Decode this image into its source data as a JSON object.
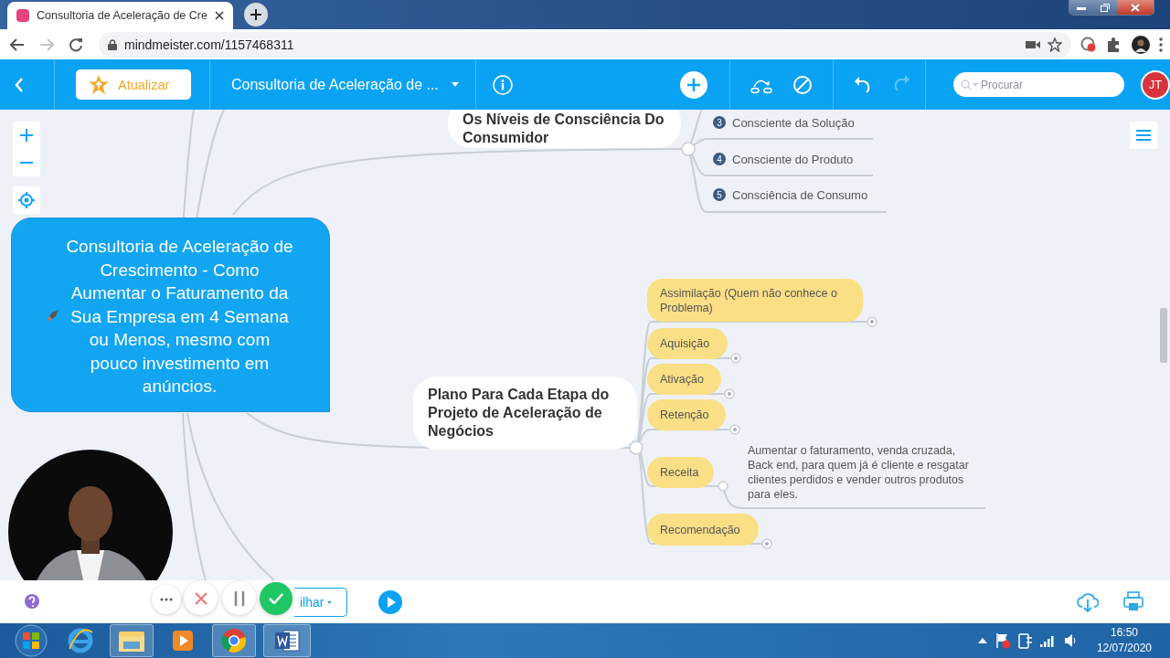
{
  "browser": {
    "tab_title": "Consultoria de Aceleração de Cre",
    "url": "mindmeister.com/1157468311",
    "forward_disabled": true
  },
  "toolbar": {
    "upgrade": "Atualizar",
    "map_title": "Consultoria de Aceleração de ...",
    "redo_disabled": true,
    "search_placeholder": "Procurar",
    "avatar": "JT"
  },
  "root": {
    "text": "Consultoria de Aceleração de Crescimento - Como Aumentar o Faturamento da Sua Empresa em 4 Semana ou Menos, mesmo com pouco investimento em anúncios."
  },
  "branches": [
    {
      "text": "Os Níveis de Consciência Do Consumidor",
      "children": [
        {
          "kind": "numbered",
          "number": "3",
          "text": "Consciente da Solução"
        },
        {
          "kind": "numbered",
          "number": "4",
          "text": "Consciente do Produto"
        },
        {
          "kind": "numbered",
          "number": "5",
          "text": "Consciência de Consumo"
        }
      ]
    },
    {
      "text": "Plano Para Cada Etapa do Projeto de Aceleração de Negócios",
      "children": [
        {
          "kind": "pill",
          "text": "Assimilação (Quem não conhece o Problema)"
        },
        {
          "kind": "pill",
          "text": "Aquisição"
        },
        {
          "kind": "pill",
          "text": "Ativação"
        },
        {
          "kind": "pill",
          "text": "Retenção"
        },
        {
          "kind": "pill",
          "text": "Receita",
          "note": "Aumentar o faturamento, venda cruzada, Back end, para quem já é cliente e resgatar clientes perdidos e vender outros produtos para eles."
        },
        {
          "kind": "pill",
          "text": "Recomendação"
        }
      ]
    }
  ],
  "bottom_bar": {
    "share": "ilhar"
  },
  "taskbar": {
    "time": "16:50",
    "date": "12/07/2020"
  }
}
